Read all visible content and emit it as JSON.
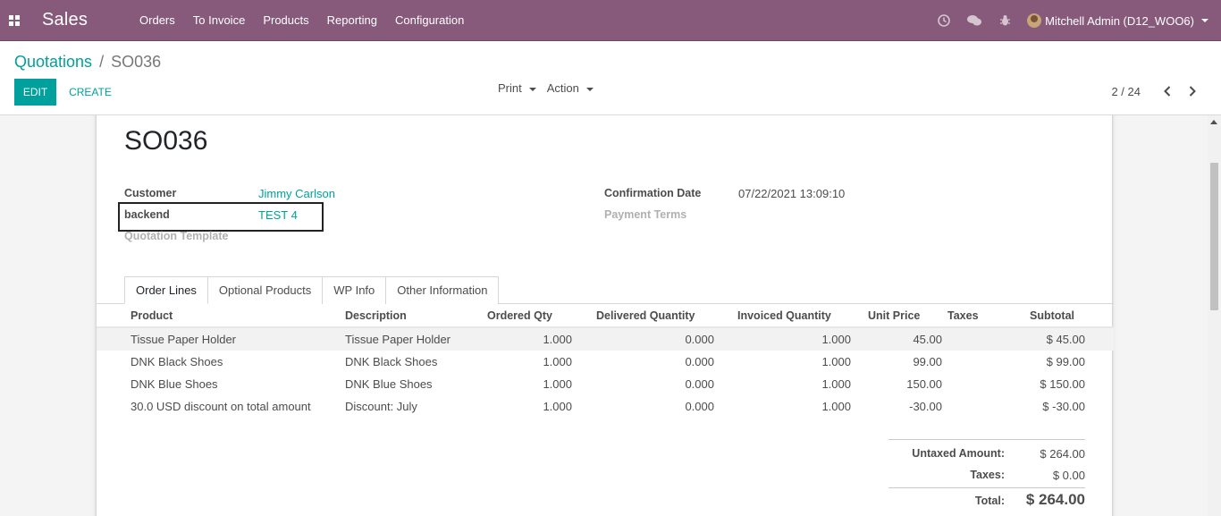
{
  "app": {
    "name": "Sales"
  },
  "menu": [
    {
      "label": "Orders"
    },
    {
      "label": "To Invoice"
    },
    {
      "label": "Products"
    },
    {
      "label": "Reporting"
    },
    {
      "label": "Configuration"
    }
  ],
  "user": {
    "name": "Mitchell Admin (D12_WOO6)"
  },
  "breadcrumb": {
    "parent": "Quotations",
    "separator": "/",
    "current": "SO036"
  },
  "buttons": {
    "edit": "EDIT",
    "create": "CREATE"
  },
  "toolbar": {
    "print": "Print",
    "action": "Action"
  },
  "pager": {
    "value": "2 / 24"
  },
  "record": {
    "name": "SO036",
    "customer_label": "Customer",
    "customer_value": "Jimmy Carlson",
    "backend_label": "backend",
    "backend_value": "TEST 4",
    "template_label": "Quotation Template",
    "confirmation_label": "Confirmation Date",
    "confirmation_value": "07/22/2021 13:09:10",
    "payment_terms_label": "Payment Terms"
  },
  "tabs": [
    {
      "label": "Order Lines"
    },
    {
      "label": "Optional Products"
    },
    {
      "label": "WP Info"
    },
    {
      "label": "Other Information"
    }
  ],
  "table": {
    "headers": [
      "Product",
      "Description",
      "Ordered Qty",
      "Delivered Quantity",
      "Invoiced Quantity",
      "Unit Price",
      "Taxes",
      "Subtotal"
    ],
    "rows": [
      {
        "product": "Tissue Paper Holder",
        "description": "Tissue Paper Holder",
        "ordered": "1.000",
        "delivered": "0.000",
        "invoiced": "1.000",
        "unit_price": "45.00",
        "taxes": "",
        "subtotal": "$ 45.00"
      },
      {
        "product": "DNK Black Shoes",
        "description": "DNK Black Shoes",
        "ordered": "1.000",
        "delivered": "0.000",
        "invoiced": "1.000",
        "unit_price": "99.00",
        "taxes": "",
        "subtotal": "$ 99.00"
      },
      {
        "product": "DNK Blue Shoes",
        "description": "DNK Blue Shoes",
        "ordered": "1.000",
        "delivered": "0.000",
        "invoiced": "1.000",
        "unit_price": "150.00",
        "taxes": "",
        "subtotal": "$ 150.00"
      },
      {
        "product": "30.0 USD discount on total amount",
        "description": "Discount: July",
        "ordered": "1.000",
        "delivered": "0.000",
        "invoiced": "1.000",
        "unit_price": "-30.00",
        "taxes": "",
        "subtotal": "$ -30.00"
      }
    ]
  },
  "totals": {
    "untaxed_label": "Untaxed Amount:",
    "untaxed_value": "$ 264.00",
    "taxes_label": "Taxes:",
    "taxes_value": "$ 0.00",
    "total_label": "Total:",
    "total_value": "$ 264.00"
  },
  "colors": {
    "navbar": "#875a7b",
    "accent": "#00a09d"
  }
}
